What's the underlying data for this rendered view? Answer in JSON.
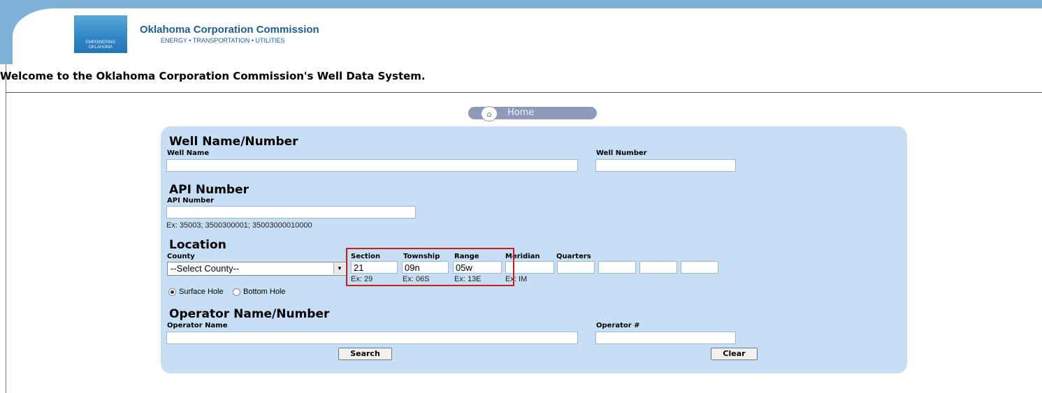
{
  "header": {
    "org_title": "Oklahoma Corporation Commission",
    "org_subtitle": "ENERGY • TRANSPORTATION • UTILITIES",
    "logo_text": "EMPOWERING OKLAHOMA"
  },
  "welcome": "Welcome to the Oklahoma Corporation Commission's Well Data System.",
  "nav": {
    "home_label": "Home",
    "home_icon": "house-icon"
  },
  "well": {
    "heading": "Well Name/Number",
    "name_label": "Well Name",
    "name_value": "",
    "number_label": "Well Number",
    "number_value": ""
  },
  "api": {
    "heading": "API Number",
    "label": "API Number",
    "value": "",
    "example": "Ex: 35003; 3500300001; 35003000010000"
  },
  "location": {
    "heading": "Location",
    "county_label": "County",
    "county_selected": "--Select County--",
    "section_label": "Section",
    "section_value": "21",
    "section_example": "Ex: 29",
    "township_label": "Township",
    "township_value": "09n",
    "township_example": "Ex: 06S",
    "range_label": "Range",
    "range_value": "05w",
    "range_example": "Ex: 13E",
    "meridian_label": "Meridian",
    "meridian_value": "",
    "meridian_example": "Ex: IM",
    "quarters_label": "Quarters",
    "quarters_values": [
      "",
      "",
      "",
      ""
    ],
    "surface_hole_label": "Surface Hole",
    "bottom_hole_label": "Bottom Hole",
    "hole_selected": "Surface Hole"
  },
  "operator": {
    "heading": "Operator Name/Number",
    "name_label": "Operator Name",
    "name_value": "",
    "number_label": "Operator #",
    "number_value": ""
  },
  "buttons": {
    "search": "Search",
    "clear": "Clear"
  },
  "colors": {
    "header_band": "#7fb2d9",
    "panel_bg": "#c7dff4",
    "highlight_border": "#d11b1b",
    "brand_text": "#1e5d99"
  }
}
